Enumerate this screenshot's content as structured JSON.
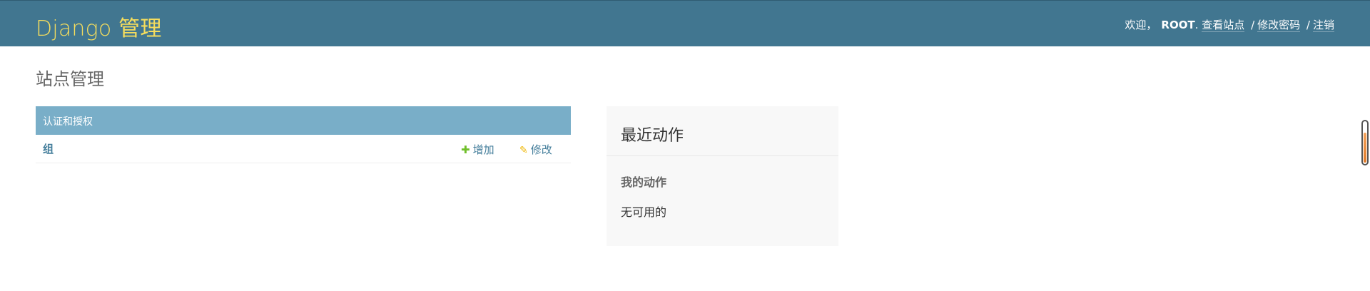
{
  "header": {
    "branding": "Django 管理",
    "welcome": "欢迎，",
    "username": "ROOT",
    "punct": ".",
    "view_site": "查看站点",
    "sep": "/",
    "change_password": "修改密码",
    "logout": "注销"
  },
  "page_title": "站点管理",
  "app_module": {
    "caption": "认证和授权",
    "rows": [
      {
        "model": "组",
        "add_label": "增加",
        "change_label": "修改"
      }
    ]
  },
  "recent_actions": {
    "title": "最近动作",
    "my_actions": "我的动作",
    "none_available": "无可用的"
  },
  "colors": {
    "header_bg": "#417690",
    "branding": "#f5dd5d",
    "caption_bg": "#79aec8",
    "link": "#447e9b",
    "add_icon": "#70bf2b",
    "change_icon": "#efb80b"
  },
  "icons": {
    "add": "plus-icon",
    "change": "pencil-icon"
  }
}
